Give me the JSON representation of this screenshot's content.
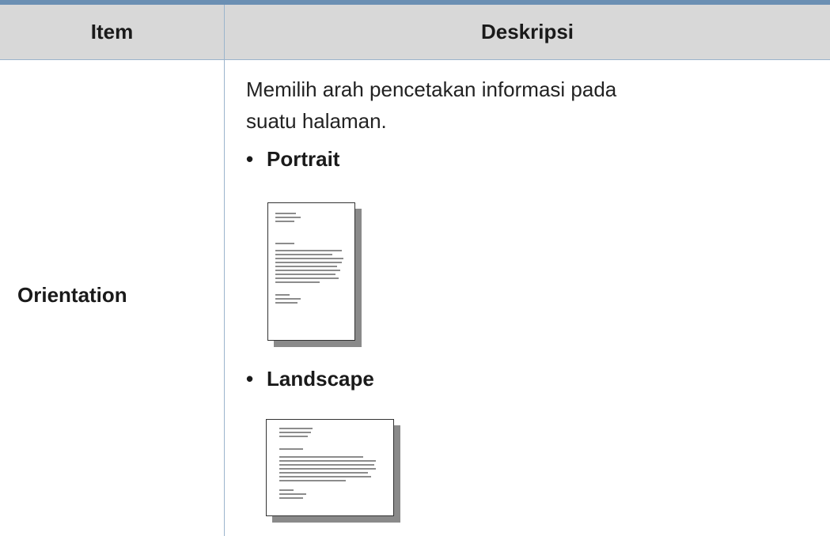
{
  "table": {
    "header": {
      "item_label": "Item",
      "description_label": "Deskripsi"
    },
    "row": {
      "item": "Orientation",
      "description": "Memilih arah pencetakan informasi pada suatu halaman.",
      "options": [
        {
          "bullet": "•",
          "label": "Portrait",
          "icon": "portrait-page-icon"
        },
        {
          "bullet": "•",
          "label": "Landscape",
          "icon": "landscape-page-icon"
        }
      ]
    }
  },
  "colors": {
    "header_background": "#d8d8d8",
    "rule": "#6b8fb3",
    "divider": "#9bb4cc"
  }
}
